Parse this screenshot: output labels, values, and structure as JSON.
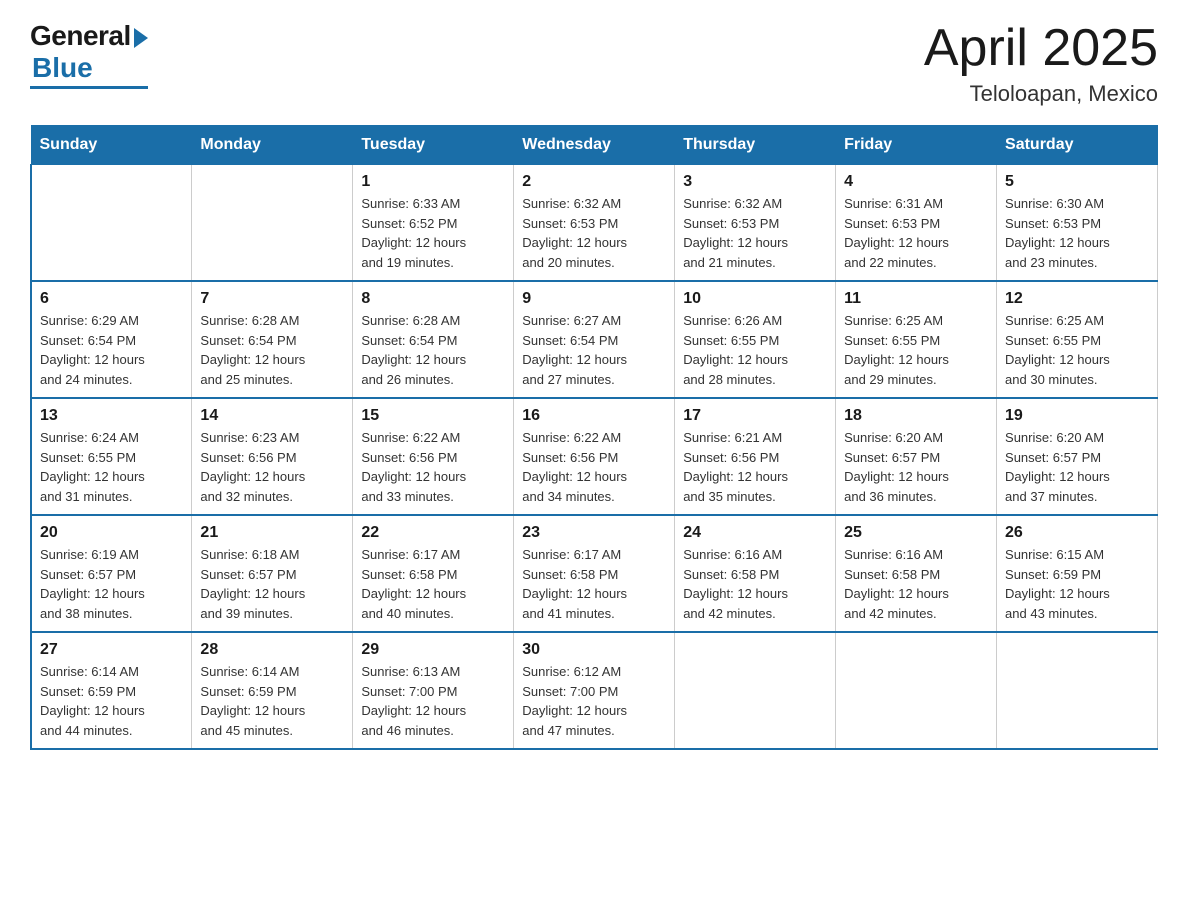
{
  "header": {
    "logo": {
      "general": "General",
      "blue": "Blue"
    },
    "title": "April 2025",
    "subtitle": "Teloloapan, Mexico"
  },
  "weekdays": [
    "Sunday",
    "Monday",
    "Tuesday",
    "Wednesday",
    "Thursday",
    "Friday",
    "Saturday"
  ],
  "weeks": [
    [
      {
        "day": "",
        "info": ""
      },
      {
        "day": "",
        "info": ""
      },
      {
        "day": "1",
        "info": "Sunrise: 6:33 AM\nSunset: 6:52 PM\nDaylight: 12 hours\nand 19 minutes."
      },
      {
        "day": "2",
        "info": "Sunrise: 6:32 AM\nSunset: 6:53 PM\nDaylight: 12 hours\nand 20 minutes."
      },
      {
        "day": "3",
        "info": "Sunrise: 6:32 AM\nSunset: 6:53 PM\nDaylight: 12 hours\nand 21 minutes."
      },
      {
        "day": "4",
        "info": "Sunrise: 6:31 AM\nSunset: 6:53 PM\nDaylight: 12 hours\nand 22 minutes."
      },
      {
        "day": "5",
        "info": "Sunrise: 6:30 AM\nSunset: 6:53 PM\nDaylight: 12 hours\nand 23 minutes."
      }
    ],
    [
      {
        "day": "6",
        "info": "Sunrise: 6:29 AM\nSunset: 6:54 PM\nDaylight: 12 hours\nand 24 minutes."
      },
      {
        "day": "7",
        "info": "Sunrise: 6:28 AM\nSunset: 6:54 PM\nDaylight: 12 hours\nand 25 minutes."
      },
      {
        "day": "8",
        "info": "Sunrise: 6:28 AM\nSunset: 6:54 PM\nDaylight: 12 hours\nand 26 minutes."
      },
      {
        "day": "9",
        "info": "Sunrise: 6:27 AM\nSunset: 6:54 PM\nDaylight: 12 hours\nand 27 minutes."
      },
      {
        "day": "10",
        "info": "Sunrise: 6:26 AM\nSunset: 6:55 PM\nDaylight: 12 hours\nand 28 minutes."
      },
      {
        "day": "11",
        "info": "Sunrise: 6:25 AM\nSunset: 6:55 PM\nDaylight: 12 hours\nand 29 minutes."
      },
      {
        "day": "12",
        "info": "Sunrise: 6:25 AM\nSunset: 6:55 PM\nDaylight: 12 hours\nand 30 minutes."
      }
    ],
    [
      {
        "day": "13",
        "info": "Sunrise: 6:24 AM\nSunset: 6:55 PM\nDaylight: 12 hours\nand 31 minutes."
      },
      {
        "day": "14",
        "info": "Sunrise: 6:23 AM\nSunset: 6:56 PM\nDaylight: 12 hours\nand 32 minutes."
      },
      {
        "day": "15",
        "info": "Sunrise: 6:22 AM\nSunset: 6:56 PM\nDaylight: 12 hours\nand 33 minutes."
      },
      {
        "day": "16",
        "info": "Sunrise: 6:22 AM\nSunset: 6:56 PM\nDaylight: 12 hours\nand 34 minutes."
      },
      {
        "day": "17",
        "info": "Sunrise: 6:21 AM\nSunset: 6:56 PM\nDaylight: 12 hours\nand 35 minutes."
      },
      {
        "day": "18",
        "info": "Sunrise: 6:20 AM\nSunset: 6:57 PM\nDaylight: 12 hours\nand 36 minutes."
      },
      {
        "day": "19",
        "info": "Sunrise: 6:20 AM\nSunset: 6:57 PM\nDaylight: 12 hours\nand 37 minutes."
      }
    ],
    [
      {
        "day": "20",
        "info": "Sunrise: 6:19 AM\nSunset: 6:57 PM\nDaylight: 12 hours\nand 38 minutes."
      },
      {
        "day": "21",
        "info": "Sunrise: 6:18 AM\nSunset: 6:57 PM\nDaylight: 12 hours\nand 39 minutes."
      },
      {
        "day": "22",
        "info": "Sunrise: 6:17 AM\nSunset: 6:58 PM\nDaylight: 12 hours\nand 40 minutes."
      },
      {
        "day": "23",
        "info": "Sunrise: 6:17 AM\nSunset: 6:58 PM\nDaylight: 12 hours\nand 41 minutes."
      },
      {
        "day": "24",
        "info": "Sunrise: 6:16 AM\nSunset: 6:58 PM\nDaylight: 12 hours\nand 42 minutes."
      },
      {
        "day": "25",
        "info": "Sunrise: 6:16 AM\nSunset: 6:58 PM\nDaylight: 12 hours\nand 42 minutes."
      },
      {
        "day": "26",
        "info": "Sunrise: 6:15 AM\nSunset: 6:59 PM\nDaylight: 12 hours\nand 43 minutes."
      }
    ],
    [
      {
        "day": "27",
        "info": "Sunrise: 6:14 AM\nSunset: 6:59 PM\nDaylight: 12 hours\nand 44 minutes."
      },
      {
        "day": "28",
        "info": "Sunrise: 6:14 AM\nSunset: 6:59 PM\nDaylight: 12 hours\nand 45 minutes."
      },
      {
        "day": "29",
        "info": "Sunrise: 6:13 AM\nSunset: 7:00 PM\nDaylight: 12 hours\nand 46 minutes."
      },
      {
        "day": "30",
        "info": "Sunrise: 6:12 AM\nSunset: 7:00 PM\nDaylight: 12 hours\nand 47 minutes."
      },
      {
        "day": "",
        "info": ""
      },
      {
        "day": "",
        "info": ""
      },
      {
        "day": "",
        "info": ""
      }
    ]
  ]
}
